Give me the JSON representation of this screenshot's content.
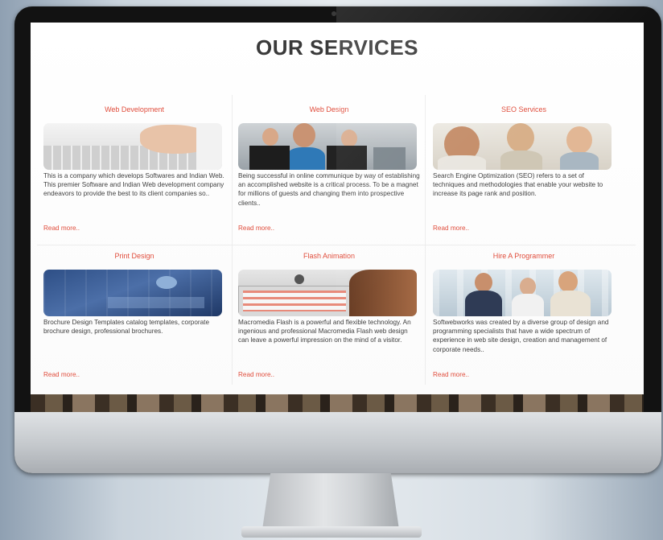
{
  "page": {
    "title": "OUR SERVICES"
  },
  "services": [
    {
      "title": "Web Development",
      "description": "This is a company which develops Softwares and Indian Web. This premier Software and Indian Web development company endeavors to provide the best to its client companies so..",
      "link": "Read more.."
    },
    {
      "title": "Web Design",
      "description": "Being successful in online communique by way of establishing an accomplished website is a critical process. To be a magnet for millions of guests and changing them into prospective clients..",
      "link": "Read more.."
    },
    {
      "title": "SEO Services",
      "description": "Search Engine Optimization (SEO) refers to a set of techniques and methodologies that enable your website to increase its page rank and position.",
      "link": "Read more.."
    },
    {
      "title": "Print Design",
      "description": "Brochure Design Templates catalog templates, corporate brochure design, professional brochures.",
      "link": "Read more.."
    },
    {
      "title": "Flash Animation",
      "description": "Macromedia Flash is a powerful and flexible technology. An ingenious and professional Macromedia Flash web design can leave a powerful impression on the mind of a visitor.",
      "link": "Read more.."
    },
    {
      "title": "Hire A Programmer",
      "description": "Softwebworks was created by a diverse group of design and programming specialists that have a wide spectrum of experience in web site design, creation and management of corporate needs..",
      "link": "Read more.."
    }
  ],
  "colors": {
    "accent": "#e04d3c",
    "heading": "#3a3a3a",
    "text": "#3f3f3f"
  }
}
